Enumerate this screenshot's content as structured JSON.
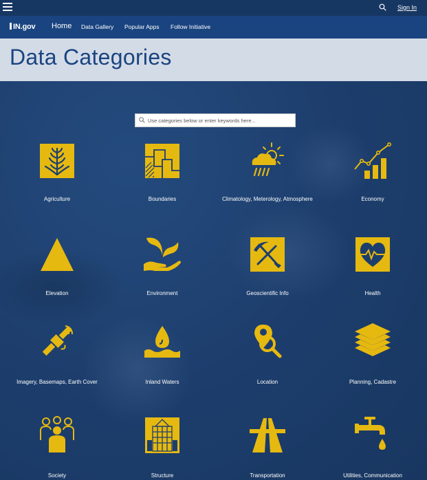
{
  "header": {
    "signin_label": "Sign In",
    "logo_text": "IN.gov",
    "nav": [
      "Home",
      "Data Gallery",
      "Popular Apps",
      "Follow Initiative"
    ]
  },
  "page_title": "Data Categories",
  "search": {
    "placeholder": "Use categories below or enter keywords here..."
  },
  "categories": [
    {
      "label": "Agriculture",
      "icon": "wheat-icon"
    },
    {
      "label": "Boundaries",
      "icon": "boundaries-map-icon"
    },
    {
      "label": "Climatology, Meterology, Atmosphere",
      "icon": "sun-rain-cloud-icon"
    },
    {
      "label": "Economy",
      "icon": "growth-chart-icon"
    },
    {
      "label": "Elevation",
      "icon": "triangle-mountain-icon"
    },
    {
      "label": "Environment",
      "icon": "plant-in-hand-icon"
    },
    {
      "label": "Geoscientific Info",
      "icon": "pickaxe-shovel-icon"
    },
    {
      "label": "Health",
      "icon": "heart-pulse-icon"
    },
    {
      "label": "Imagery, Basemaps, Earth Cover",
      "icon": "satellite-icon"
    },
    {
      "label": "Inland Waters",
      "icon": "water-drop-icon"
    },
    {
      "label": "Location",
      "icon": "location-pin-search-icon"
    },
    {
      "label": "Planning, Cadastre",
      "icon": "layers-icon"
    },
    {
      "label": "Society",
      "icon": "people-group-icon"
    },
    {
      "label": "Structure",
      "icon": "building-icon"
    },
    {
      "label": "Transportation",
      "icon": "highway-icon"
    },
    {
      "label": "Utilities, Communication",
      "icon": "faucet-icon"
    }
  ],
  "colors": {
    "topbar": "#173763",
    "navbar": "#1a4480",
    "title_band": "#d3dbe7",
    "accent_gold": "#e6b911",
    "background": "#1d3e6d"
  }
}
